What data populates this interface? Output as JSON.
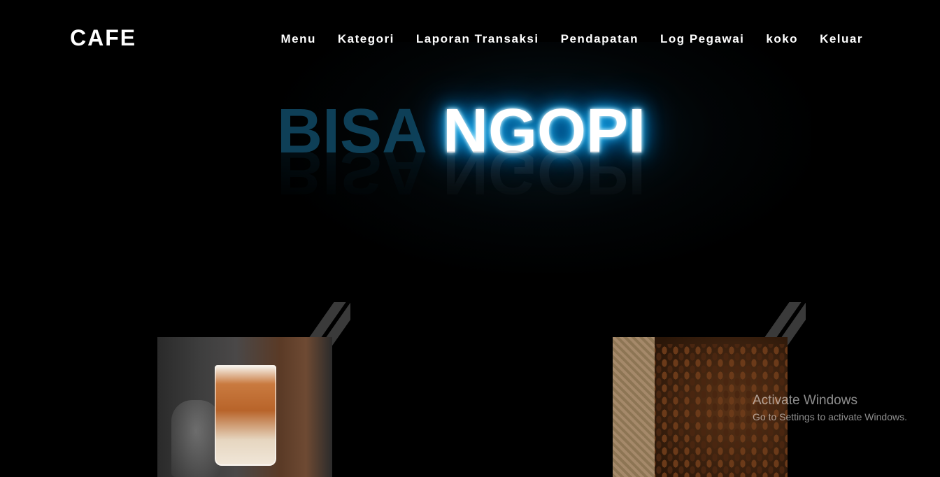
{
  "brand": "CAFE",
  "nav": {
    "menu": "Menu",
    "kategori": "Kategori",
    "laporan": "Laporan Transaksi",
    "pendapatan": "Pendapatan",
    "log": "Log Pegawai",
    "user": "koko",
    "keluar": "Keluar"
  },
  "hero": {
    "word1": "BISA",
    "word2": "NGOPI",
    "accent_color": "#00a8ff"
  },
  "watermark": {
    "title": "Activate Windows",
    "subtitle": "Go to Settings to activate Windows."
  }
}
